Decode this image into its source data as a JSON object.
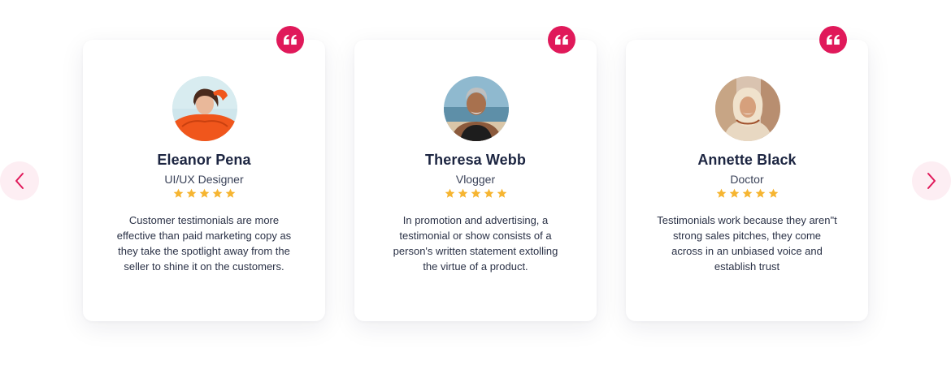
{
  "colors": {
    "accent": "#e0195a",
    "star": "#f6b531",
    "name": "#1c2541",
    "text": "#2a3146",
    "arrow_bg": "#fdeef3"
  },
  "navigation": {
    "prev_icon": "chevron-left-icon",
    "next_icon": "chevron-right-icon"
  },
  "testimonials": [
    {
      "name": "Eleanor Pena",
      "role": "UI/UX Designer",
      "rating": 5,
      "quote": "Customer testimonials are more effective than paid marketing copy as they take the spotlight away from the seller to shine it on the customers.",
      "quote_icon": "quote-icon"
    },
    {
      "name": "Theresa Webb",
      "role": "Vlogger",
      "rating": 5,
      "quote": "In promotion and advertising, a testimonial or show consists of a person's written statement extolling the virtue of a product.",
      "quote_icon": "quote-icon"
    },
    {
      "name": "Annette Black",
      "role": "Doctor",
      "rating": 5,
      "quote": "Testimonials work because they aren\"t strong sales pitches, they come across in an unbiased voice and establish trust",
      "quote_icon": "quote-icon"
    }
  ]
}
